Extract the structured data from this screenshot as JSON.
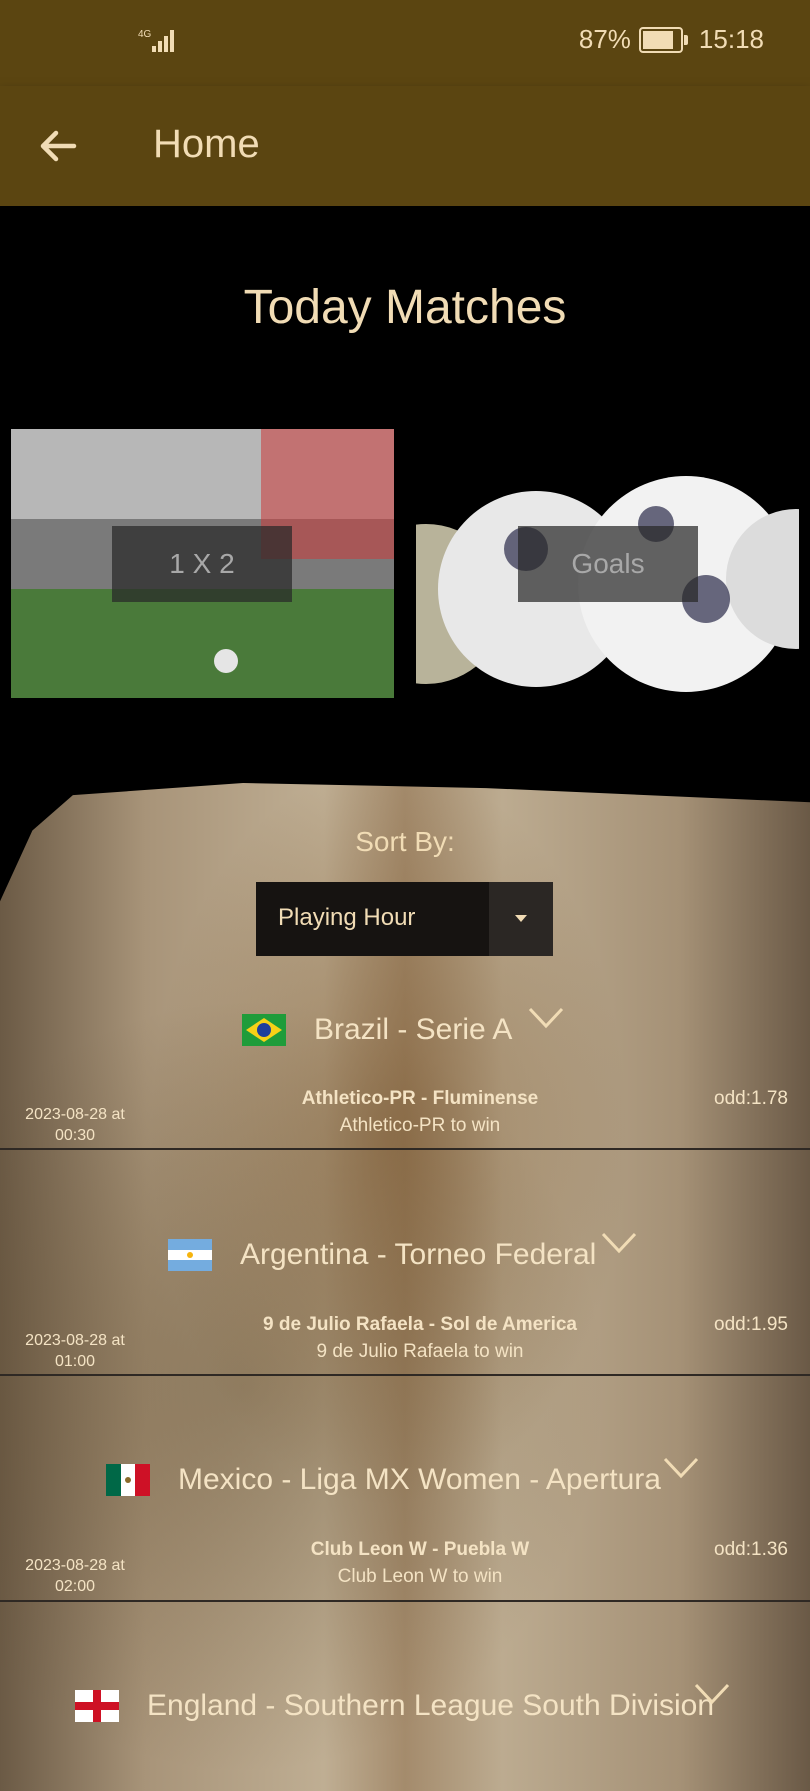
{
  "status": {
    "network": "4G",
    "battery": "87%",
    "time": "15:18"
  },
  "appbar": {
    "title": "Home"
  },
  "page": {
    "title": "Today Matches"
  },
  "tiles": [
    {
      "label": "1 X 2"
    },
    {
      "label": "Goals"
    }
  ],
  "sort": {
    "label": "Sort By:",
    "selected": "Playing Hour"
  },
  "leagues": [
    {
      "name": "Brazil - Serie A",
      "flag": "brazil-flag",
      "match": {
        "date": "2023-08-28 at",
        "time": "00:30",
        "teams": "Athletico-PR - Fluminense",
        "pick": "Athletico-PR to win",
        "odd": "odd:1.78"
      }
    },
    {
      "name": "Argentina - Torneo Federal",
      "flag": "argentina-flag",
      "match": {
        "date": "2023-08-28 at",
        "time": "01:00",
        "teams": "9 de Julio Rafaela - Sol de America",
        "pick": "9 de Julio Rafaela to win",
        "odd": "odd:1.95"
      }
    },
    {
      "name": "Mexico - Liga MX Women - Apertura",
      "flag": "mexico-flag",
      "match": {
        "date": "2023-08-28 at",
        "time": "02:00",
        "teams": "Club Leon W - Puebla W",
        "pick": "Club Leon W to win",
        "odd": "odd:1.36"
      }
    },
    {
      "name": "England - Southern League South Division",
      "flag": "england-flag"
    }
  ],
  "colors": {
    "appbar": "#5b4511",
    "accent_text": "#f1dcb5",
    "background": "#000000"
  }
}
